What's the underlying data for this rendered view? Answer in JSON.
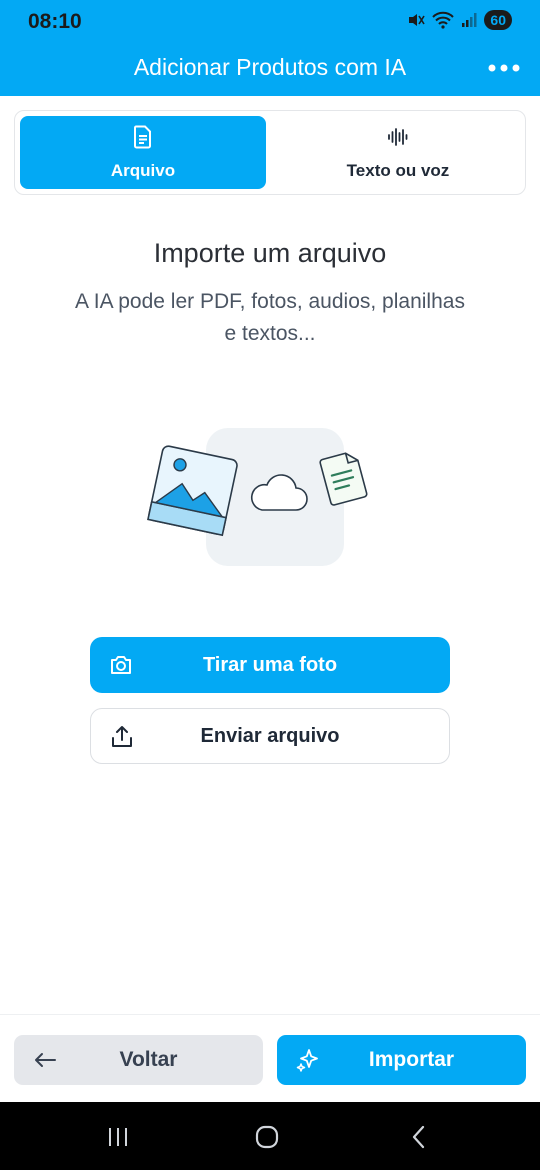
{
  "status_bar": {
    "time": "08:10",
    "battery": "60"
  },
  "app_bar": {
    "title": "Adicionar Produtos com IA",
    "more_icon": "more-horizontal-icon"
  },
  "tabs": [
    {
      "label": "Arquivo",
      "icon": "document-icon",
      "active": true
    },
    {
      "label": "Texto ou voz",
      "icon": "waveform-icon",
      "active": false
    }
  ],
  "main": {
    "heading": "Importe um arquivo",
    "subtext": "A IA pode ler PDF, fotos, audios, planilhas e textos..."
  },
  "actions": {
    "take_photo": "Tirar uma foto",
    "send_file": "Enviar arquivo"
  },
  "footer": {
    "back": "Voltar",
    "import": "Importar"
  },
  "colors": {
    "accent": "#03a9f4",
    "back_button_bg": "#e5e7eb"
  }
}
